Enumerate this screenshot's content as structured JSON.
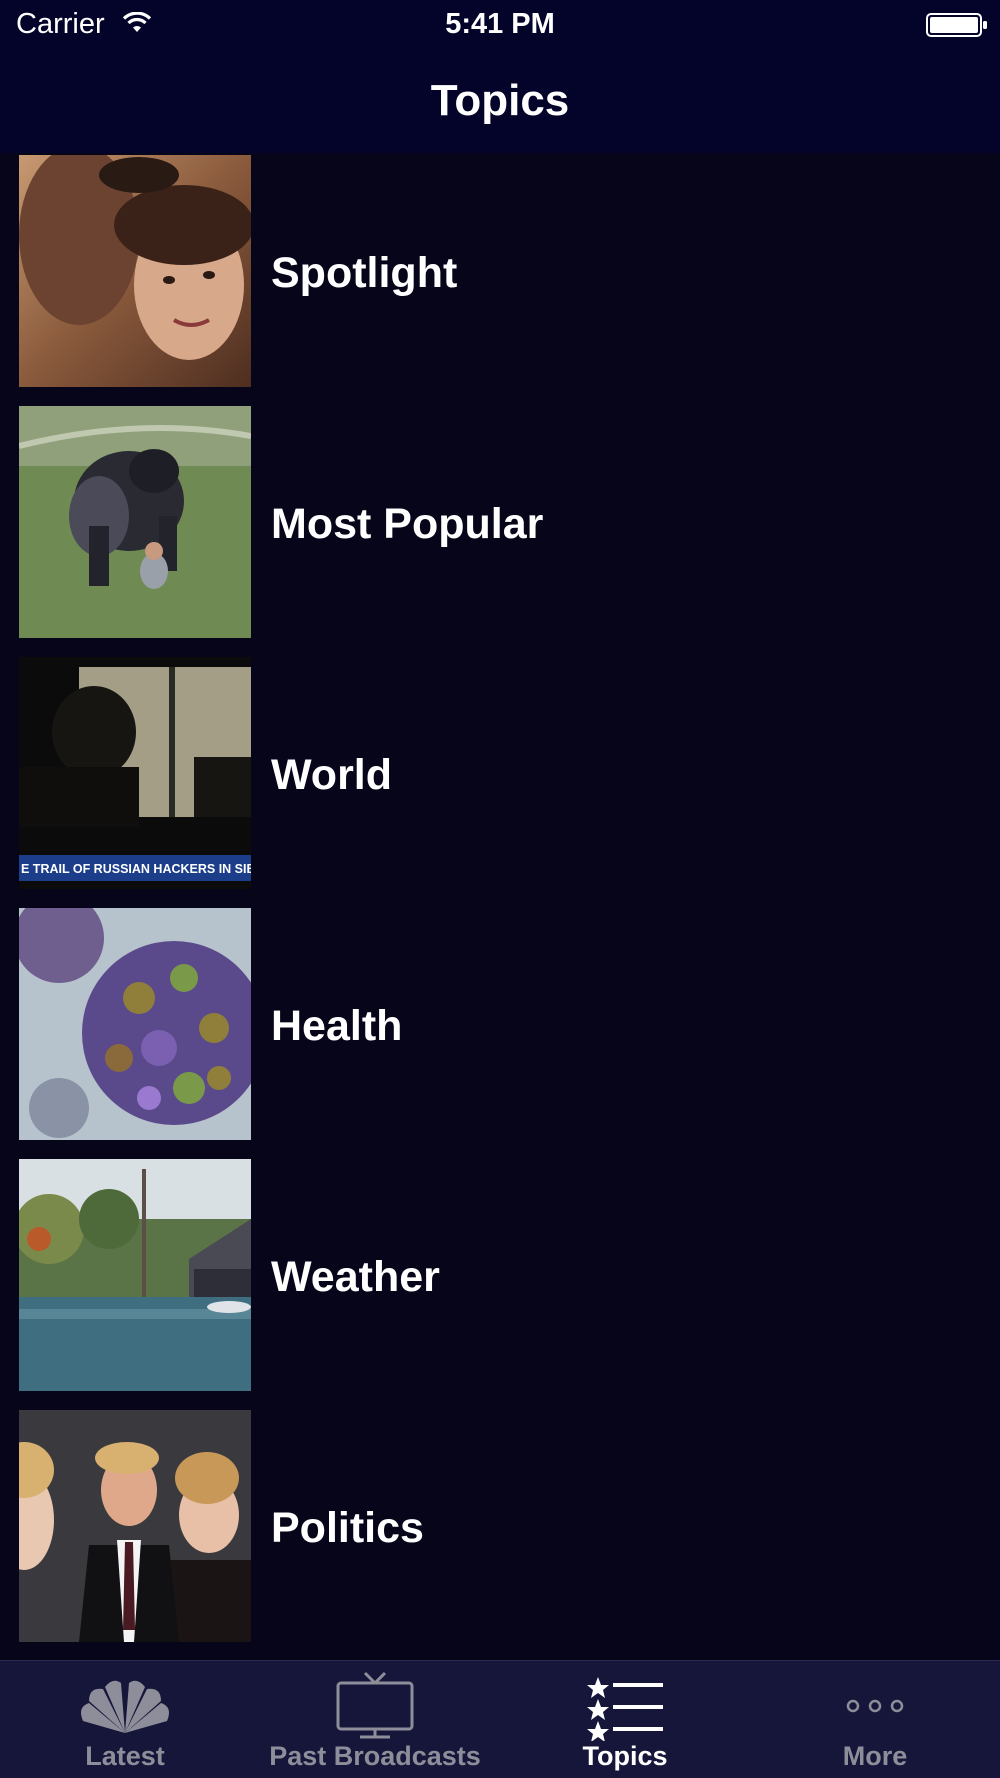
{
  "status_bar": {
    "carrier": "Carrier",
    "time": "5:41 PM",
    "icons": [
      "wifi-icon",
      "battery-icon"
    ]
  },
  "nav": {
    "title": "Topics"
  },
  "topics": [
    {
      "label": "Spotlight",
      "thumbnail": "couple-photo"
    },
    {
      "label": "Most Popular",
      "thumbnail": "gorilla-photo"
    },
    {
      "label": "World",
      "thumbnail": "silhouette-photo",
      "caption": "E TRAIL OF RUSSIAN HACKERS IN SIBERIA"
    },
    {
      "label": "Health",
      "thumbnail": "virus-photo"
    },
    {
      "label": "Weather",
      "thumbnail": "flood-photo"
    },
    {
      "label": "Politics",
      "thumbnail": "people-photo"
    }
  ],
  "tab_bar": {
    "tabs": [
      {
        "label": "Latest",
        "icon": "peacock-icon",
        "active": false
      },
      {
        "label": "Past Broadcasts",
        "icon": "tv-icon",
        "active": false
      },
      {
        "label": "Topics",
        "icon": "star-list-icon",
        "active": true
      },
      {
        "label": "More",
        "icon": "more-dots-icon",
        "active": false
      }
    ]
  },
  "colors": {
    "bar_background": "#04032a",
    "list_background": "#06051a",
    "tab_background": "#16163a",
    "tab_inactive": "#8e8e9a",
    "tab_active": "#ffffff"
  }
}
